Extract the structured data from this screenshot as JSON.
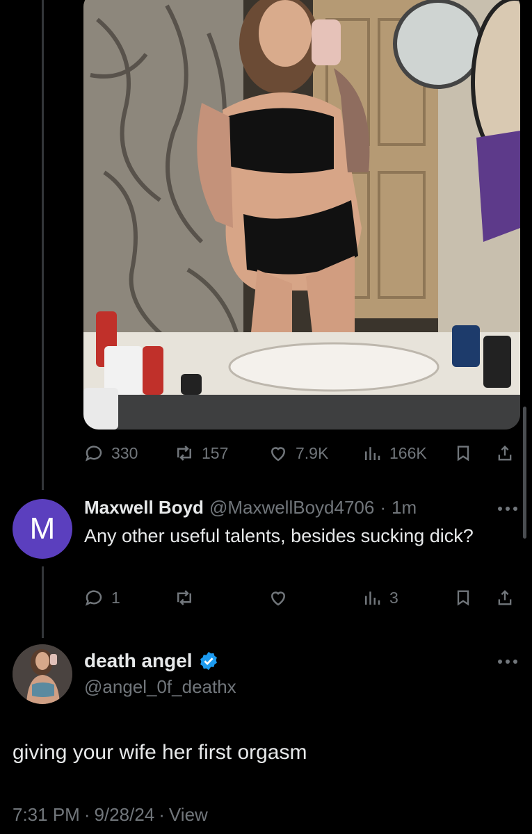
{
  "media": {
    "alt": "selfie photo"
  },
  "post_stats": {
    "replies": "330",
    "reposts": "157",
    "likes": "7.9K",
    "views": "166K"
  },
  "reply": {
    "avatar_letter": "M",
    "avatar_color": "#5b3fbe",
    "name": "Maxwell Boyd",
    "handle": "@MaxwellBoyd4706",
    "separator": "·",
    "time": "1m",
    "text": "Any other useful talents, besides sucking dick?",
    "stats": {
      "replies": "1",
      "reposts": "",
      "likes": "",
      "views": "3"
    }
  },
  "main_tweet": {
    "name": "death angel",
    "verified": true,
    "handle": "@angel_0f_deathx",
    "text": "giving your wife her first orgasm",
    "time": "7:31 PM",
    "date": "9/28/24",
    "view_link": "View",
    "separator": "·"
  },
  "icons": {
    "reply": "speech-bubble-icon",
    "repost": "repost-icon",
    "like": "heart-icon",
    "views": "bar-chart-icon",
    "bookmark": "bookmark-icon",
    "share": "share-icon",
    "more": "more-dots-icon",
    "verified": "verified-badge-icon"
  },
  "colors": {
    "background": "#000000",
    "text": "#e7e9ea",
    "muted": "#71767b",
    "verified": "#1d9bf0"
  }
}
